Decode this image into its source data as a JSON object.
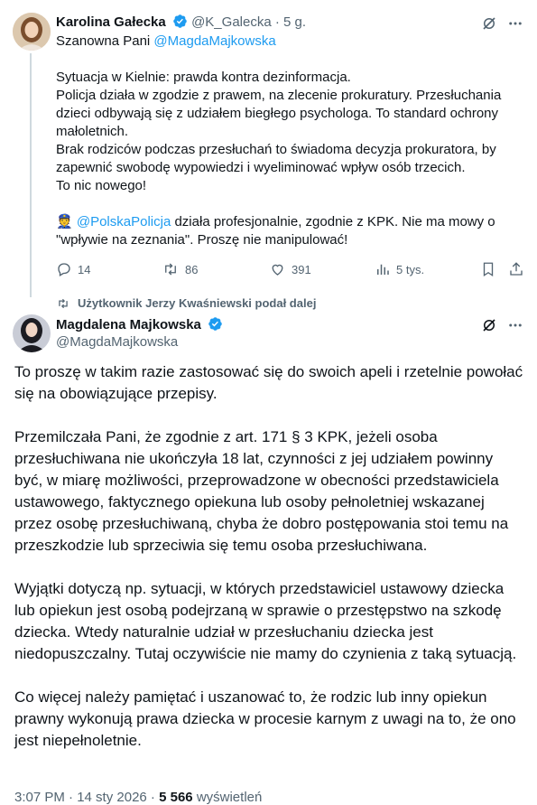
{
  "tweet1": {
    "author_name": "Karolina Gałecka",
    "handle": "@K_Galecka",
    "separator": "·",
    "time": "5 g.",
    "greeting": "Szanowna Pani",
    "mention": "@MagdaMajkowska",
    "lines": [
      "Sytuacja w Kielnie: prawda kontra dezinformacja.",
      "Policja działa w zgodzie z prawem, na zlecenie prokuratury. Przesłuchania dzieci odbywają się z udziałem biegłego psychologa. To standard ochrony małoletnich.",
      "Brak rodziców podczas przesłuchań to świadoma decyzja prokuratora, by zapewnić swobodę wypowiedzi i wyeliminować wpływ osób trzecich.",
      "To nic nowego!"
    ],
    "police_emoji": "👮",
    "police_mention": "@PolskaPolicja",
    "police_text": " działa profesjonalnie, zgodnie z KPK. Nie ma mowy o \"wpływie na zeznania\". Proszę nie manipulować!",
    "replies": "14",
    "reposts": "86",
    "likes": "391",
    "views": "5 tys."
  },
  "repost_notice": "Użytkownik Jerzy Kwaśniewski podał dalej",
  "tweet2": {
    "author_name": "Magdalena Majkowska",
    "handle": "@MagdaMajkowska",
    "paragraphs": [
      "To proszę w takim razie zastosować się do swoich apeli i rzetelnie powołać się na obowiązujące przepisy.",
      "Przemilczała Pani, że zgodnie z art. 171 § 3 KPK, jeżeli osoba przesłuchiwana nie ukończyła 18 lat, czynności z jej udziałem powinny być, w miarę możliwości, przeprowadzone w obecności przedstawiciela ustawowego, faktycznego opiekuna lub osoby pełnoletniej wskazanej przez osobę przesłuchiwaną, chyba że dobro postępowania stoi temu na przeszkodzie lub sprzeciwia się temu osoba przesłuchiwana.",
      "Wyjątki dotyczą np. sytuacji, w których przedstawiciel ustawowy dziecka lub opiekun jest osobą podejrzaną w sprawie o przestępstwo na szkodę dziecka. Wtedy naturalnie udział w przesłuchaniu dziecka jest niedopuszczalny. Tutaj oczywiście nie mamy do czynienia z taką sytuacją.",
      "Co więcej należy pamiętać i uszanować to, że rodzic lub inny opiekun prawny wykonują prawa dziecka w procesie karnym z uwagi na to, że ono jest niepełnoletnie."
    ],
    "timestamp": "3:07 PM · 14 sty 2026 ·",
    "views": "5 566",
    "views_label": "wyświetleń"
  },
  "colors": {
    "accent": "#1d9bf0",
    "muted": "#536471",
    "text": "#0f1419"
  },
  "icons": [
    "verified-badge",
    "grok-icon",
    "more-icon",
    "reply-icon",
    "repost-icon",
    "like-icon",
    "views-icon",
    "bookmark-icon",
    "share-icon"
  ]
}
